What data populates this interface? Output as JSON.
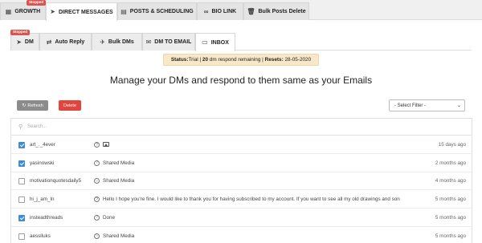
{
  "top_tabs": [
    {
      "label": "GROWTH",
      "icon": "stopped-badge-growth",
      "badge": "Stopped"
    },
    {
      "label": "DIRECT MESSAGES",
      "icon": "paper-plane-icon"
    },
    {
      "label": "POSTS & SCHEDULING",
      "icon": "calendar-icon"
    },
    {
      "label": "BIO LINK",
      "icon": "link-icon"
    },
    {
      "label": "Bulk Posts Delete",
      "icon": "trash-icon"
    }
  ],
  "sub_tabs": [
    {
      "label": "DM",
      "icon": "paper-plane-icon",
      "badge": "Stopped"
    },
    {
      "label": "Auto Reply",
      "icon": "refresh-icon"
    },
    {
      "label": "Bulk DMs",
      "icon": "send-icon"
    },
    {
      "label": "DM TO EMAIL",
      "icon": "envelope-icon"
    },
    {
      "label": "INBOX",
      "icon": "inbox-icon"
    }
  ],
  "status": {
    "prefix": "Status:",
    "plan": "Trial",
    "sep1": " | ",
    "count": "20",
    "count_suffix": " dm respond remaining",
    "sep2": " | ",
    "resets_label": "Resets:",
    "resets_value": " 28-05-2020"
  },
  "headline": "Manage your DMs and respond to them same as your Emails",
  "toolbar": {
    "refresh_label": "Refresh",
    "delete_label": "Delete",
    "filter_placeholder": "- Select Filter -"
  },
  "search": {
    "placeholder": "Search..."
  },
  "messages": [
    {
      "checked": true,
      "username": "art_._4ever",
      "icon": "question-icon",
      "message": "",
      "has_image": true,
      "time": "15 days ago"
    },
    {
      "checked": true,
      "username": "yasinowski",
      "icon": "question-icon",
      "message": "Shared Media",
      "has_image": false,
      "time": "2 months ago"
    },
    {
      "checked": false,
      "username": "motivationquotesdaily5",
      "icon": "check-circle-icon",
      "message": "Shared Media",
      "has_image": false,
      "time": "4 months ago"
    },
    {
      "checked": false,
      "username": "hi_j_am_ln",
      "icon": "question-icon",
      "message": "Hello I hope you're fine. I would like to thank you for having subscribed to my account. If you want to see all my old drawings and son",
      "has_image": false,
      "time": "5 months ago"
    },
    {
      "checked": true,
      "username": "insteadthreads",
      "icon": "question-icon",
      "message": "Done",
      "has_image": false,
      "time": "5 months ago"
    },
    {
      "checked": false,
      "username": "aesslluks",
      "icon": "check-circle-icon",
      "message": "Shared Media",
      "has_image": false,
      "time": "5 months ago"
    }
  ],
  "colors": {
    "stopped": "#d9534f",
    "status_bg": "#f8e7c8",
    "checkbox": "#3b8ed6",
    "delete": "#e0453e",
    "refresh": "#8c8c8c"
  }
}
